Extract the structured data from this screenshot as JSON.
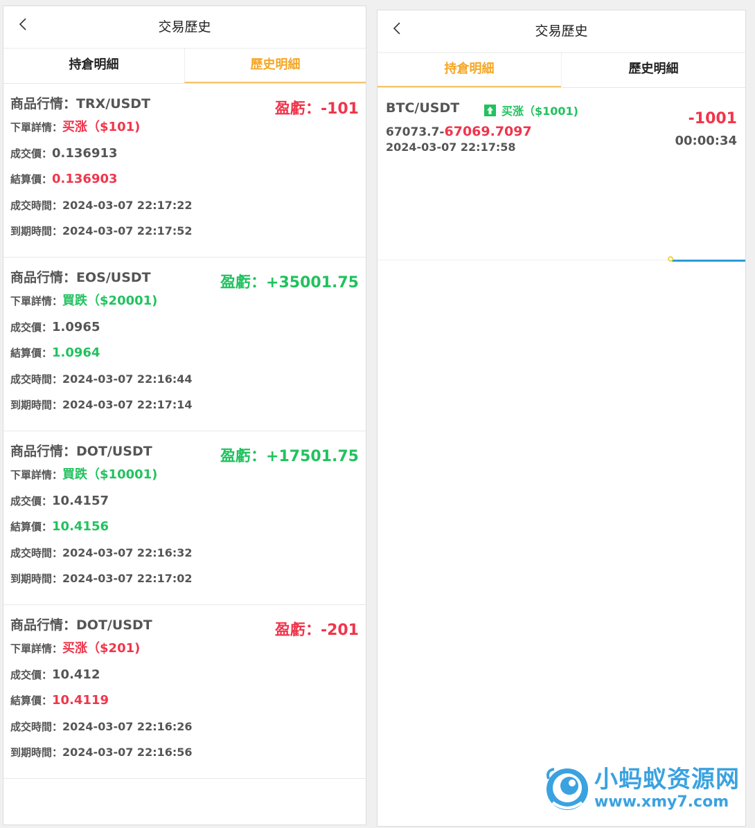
{
  "app": {
    "title": "交易歷史"
  },
  "tabs": [
    {
      "label": "持倉明細"
    },
    {
      "label": "歷史明細"
    }
  ],
  "labels": {
    "market": "商品行情：",
    "pnl": "盈虧：",
    "order_detail": "下單詳情：",
    "deal_price": "成交價：",
    "settle_price": "結算價：",
    "deal_time": "成交時間：",
    "expire_time": "到期時間："
  },
  "history": [
    {
      "symbol": "TRX/USDT",
      "pnl": "-101",
      "pnl_color": "#f0354b",
      "order": "买涨（$101)",
      "order_color": "#f0354b",
      "deal_price": "0.136913",
      "settle_price": "0.136903",
      "settle_color": "#f0354b",
      "deal_time": "2024-03-07 22:17:22",
      "expire_time": "2024-03-07 22:17:52"
    },
    {
      "symbol": "EOS/USDT",
      "pnl": "+35001.75",
      "pnl_color": "#21c25e",
      "order": "買跌（$20001)",
      "order_color": "#21c25e",
      "deal_price": "1.0965",
      "settle_price": "1.0964",
      "settle_color": "#21c25e",
      "deal_time": "2024-03-07 22:16:44",
      "expire_time": "2024-03-07 22:17:14"
    },
    {
      "symbol": "DOT/USDT",
      "pnl": "+17501.75",
      "pnl_color": "#21c25e",
      "order": "買跌（$10001)",
      "order_color": "#21c25e",
      "deal_price": "10.4157",
      "settle_price": "10.4156",
      "settle_color": "#21c25e",
      "deal_time": "2024-03-07 22:16:32",
      "expire_time": "2024-03-07 22:17:02"
    },
    {
      "symbol": "DOT/USDT",
      "pnl": "-201",
      "pnl_color": "#f0354b",
      "order": "买涨（$201)",
      "order_color": "#f0354b",
      "deal_price": "10.412",
      "settle_price": "10.4119",
      "settle_color": "#f0354b",
      "deal_time": "2024-03-07 22:16:26",
      "expire_time": "2024-03-07 22:16:56"
    }
  ],
  "position": {
    "symbol": "BTC/USDT",
    "direction": "买涨（$1001)",
    "pnl": "-1001",
    "open_price": "67073.7-",
    "current_price": "67069.7097",
    "time": "2024-03-07 22:17:58",
    "countdown": "00:00:34",
    "progress_remaining": 0.2
  },
  "watermark": {
    "title": "小蚂蚁资源网",
    "url": "www.xmy7.com"
  },
  "colors": {
    "accent": "#f5a623",
    "red": "#f0354b",
    "green": "#21c25e",
    "progress": "#2a9bd8"
  }
}
